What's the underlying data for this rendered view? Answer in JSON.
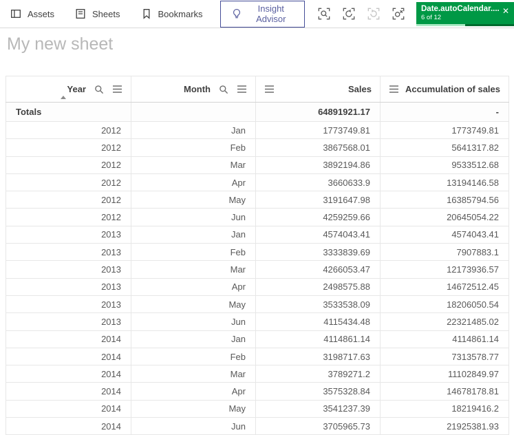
{
  "toolbar": {
    "assets": "Assets",
    "sheets": "Sheets",
    "bookmarks": "Bookmarks",
    "insight_advisor": "Insight Advisor"
  },
  "selections": {
    "chip": {
      "field": "Date.autoCalendar....",
      "count_text": "6 of 12",
      "selected": 6,
      "total": 12
    }
  },
  "icons": {
    "assets": "panel-left",
    "sheets": "sheet",
    "bookmarks": "bookmark",
    "insight_advisor": "lightbulb",
    "selections_tool": "search-in-brackets",
    "step_back": "undo-arrow",
    "step_forward": "redo-arrow",
    "clear_selections": "clear-circle-x",
    "chip_close": "✕",
    "column_search": "magnifier",
    "column_menu": "hamburger",
    "sort_ascending": "▲"
  },
  "colors": {
    "selection_green": "#009845",
    "insight_advisor_purple": "#595f9f",
    "title_gray": "#b8b8b8"
  },
  "sheet": {
    "title": "My new sheet"
  },
  "table": {
    "columns": [
      {
        "label": "Year",
        "type": "dimension",
        "sort": "asc"
      },
      {
        "label": "Month",
        "type": "dimension",
        "sort": null
      },
      {
        "label": "Sales",
        "type": "measure",
        "sort": null
      },
      {
        "label": "Accumulation of sales",
        "type": "measure",
        "sort": null
      }
    ],
    "totals": {
      "label": "Totals",
      "month": "",
      "sales": "64891921.17",
      "accumulation": "-"
    },
    "rows": [
      [
        "2012",
        "Jan",
        "1773749.81",
        "1773749.81"
      ],
      [
        "2012",
        "Feb",
        "3867568.01",
        "5641317.82"
      ],
      [
        "2012",
        "Mar",
        "3892194.86",
        "9533512.68"
      ],
      [
        "2012",
        "Apr",
        "3660633.9",
        "13194146.58"
      ],
      [
        "2012",
        "May",
        "3191647.98",
        "16385794.56"
      ],
      [
        "2012",
        "Jun",
        "4259259.66",
        "20645054.22"
      ],
      [
        "2013",
        "Jan",
        "4574043.41",
        "4574043.41"
      ],
      [
        "2013",
        "Feb",
        "3333839.69",
        "7907883.1"
      ],
      [
        "2013",
        "Mar",
        "4266053.47",
        "12173936.57"
      ],
      [
        "2013",
        "Apr",
        "2498575.88",
        "14672512.45"
      ],
      [
        "2013",
        "May",
        "3533538.09",
        "18206050.54"
      ],
      [
        "2013",
        "Jun",
        "4115434.48",
        "22321485.02"
      ],
      [
        "2014",
        "Jan",
        "4114861.14",
        "4114861.14"
      ],
      [
        "2014",
        "Feb",
        "3198717.63",
        "7313578.77"
      ],
      [
        "2014",
        "Mar",
        "3789271.2",
        "11102849.97"
      ],
      [
        "2014",
        "Apr",
        "3575328.84",
        "14678178.81"
      ],
      [
        "2014",
        "May",
        "3541237.39",
        "18219416.2"
      ],
      [
        "2014",
        "Jun",
        "3705965.73",
        "21925381.93"
      ]
    ]
  }
}
